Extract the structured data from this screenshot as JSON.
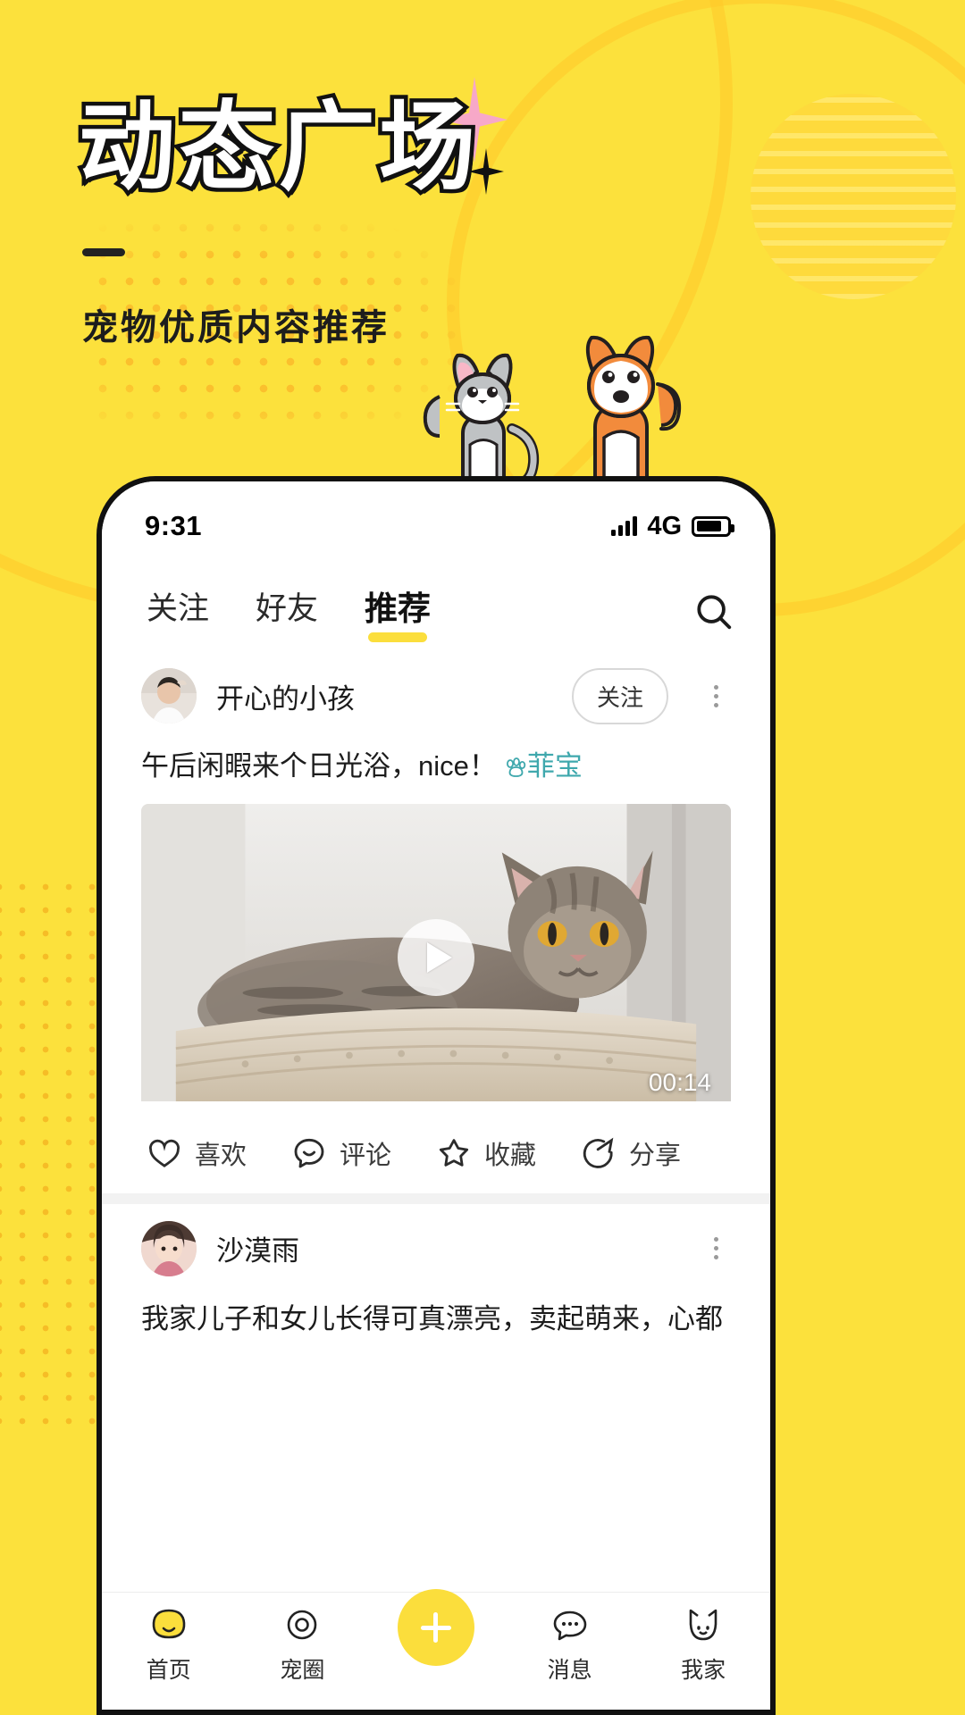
{
  "poster": {
    "title": "动态广场",
    "subtitle": "宠物优质内容推荐",
    "bg_color": "#FCE13C",
    "accent_color": "#FBDE3C",
    "sparkle_color": "#F7A8C8"
  },
  "status_bar": {
    "time": "9:31",
    "network": "4G",
    "signal_icon": "signal-bars-icon",
    "battery_icon": "battery-icon"
  },
  "tabs": [
    {
      "label": "关注",
      "active": false
    },
    {
      "label": "好友",
      "active": false
    },
    {
      "label": "推荐",
      "active": true
    }
  ],
  "search": {
    "icon": "search-icon"
  },
  "posts": [
    {
      "username": "开心的小孩",
      "avatar_icon": "avatar",
      "follow_label": "关注",
      "more_icon": "more-vertical-icon",
      "caption": "午后闲暇来个日光浴，nice！",
      "pet_tag": "菲宝",
      "pet_tag_color": "#3FA8AD",
      "media_type": "video",
      "duration": "00:14",
      "play_icon": "play-icon",
      "actions": [
        {
          "label": "喜欢",
          "icon": "heart-icon"
        },
        {
          "label": "评论",
          "icon": "comment-icon"
        },
        {
          "label": "收藏",
          "icon": "star-icon"
        },
        {
          "label": "分享",
          "icon": "share-icon"
        }
      ]
    },
    {
      "username": "沙漠雨",
      "avatar_icon": "avatar",
      "more_icon": "more-vertical-icon",
      "caption": "我家儿子和女儿长得可真漂亮，卖起萌来，心都"
    }
  ],
  "bottom_nav": [
    {
      "label": "首页",
      "icon": "home-icon"
    },
    {
      "label": "宠圈",
      "icon": "circle-icon"
    },
    {
      "label": "",
      "icon": "plus-icon"
    },
    {
      "label": "消息",
      "icon": "message-icon"
    },
    {
      "label": "我家",
      "icon": "cat-icon"
    }
  ]
}
